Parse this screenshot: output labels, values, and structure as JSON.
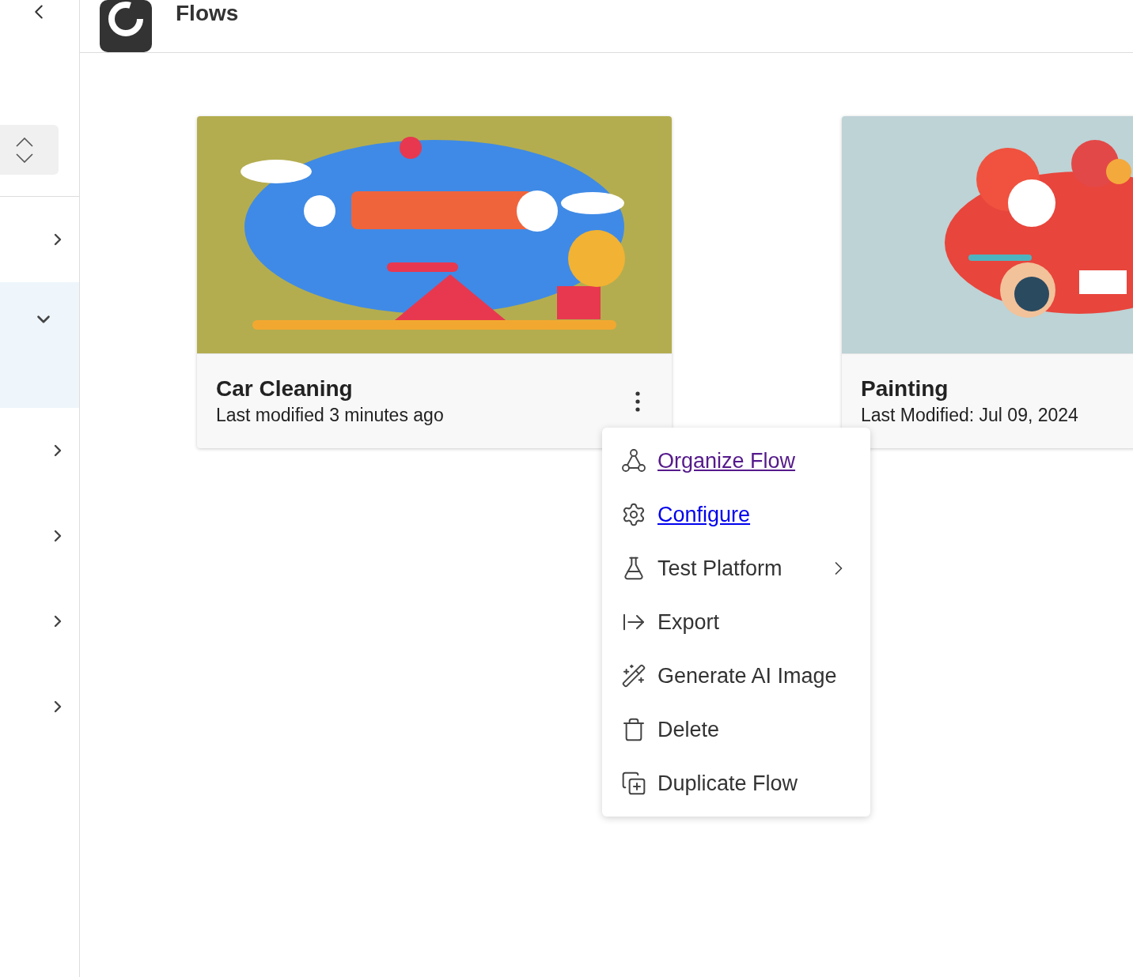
{
  "header": {
    "title": "Flows"
  },
  "sidebar": {
    "items": [
      {
        "expanded": false
      },
      {
        "expanded": true
      },
      {
        "expanded": false
      },
      {
        "expanded": false
      },
      {
        "expanded": false
      },
      {
        "expanded": false
      }
    ]
  },
  "cards": [
    {
      "title": "Car Cleaning",
      "subtitle": "Last modified 3 minutes ago",
      "menu": [
        {
          "label": "Organize Flow",
          "kind": "link",
          "visited": true
        },
        {
          "label": "Configure",
          "kind": "link",
          "visited": false
        },
        {
          "label": "Test Platform",
          "kind": "submenu"
        },
        {
          "label": "Export",
          "kind": "action"
        },
        {
          "label": "Generate AI Image",
          "kind": "action"
        },
        {
          "label": "Delete",
          "kind": "action"
        },
        {
          "label": "Duplicate Flow",
          "kind": "action"
        }
      ]
    },
    {
      "title": "Painting",
      "subtitle": "Last Modified: Jul 09, 2024"
    }
  ]
}
